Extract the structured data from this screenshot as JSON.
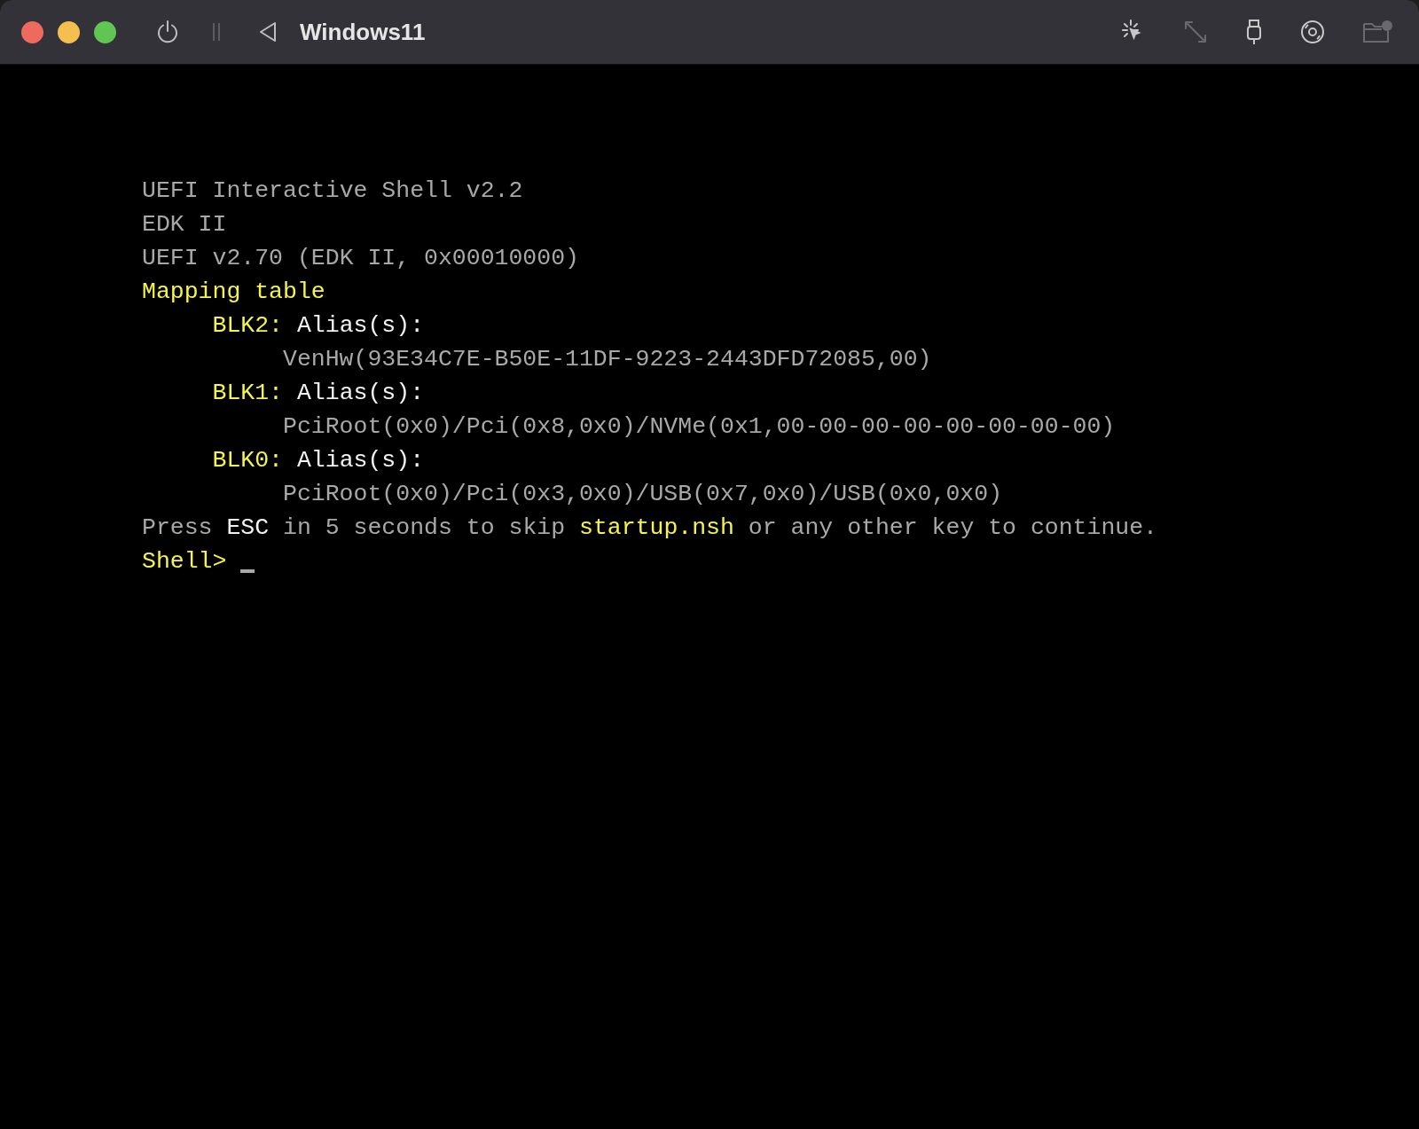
{
  "window": {
    "title": "Windows11"
  },
  "terminal": {
    "cursor": true,
    "lines": [
      {
        "segments": [
          {
            "kind": "plain",
            "text": "UEFI Interactive Shell v2.2"
          }
        ]
      },
      {
        "segments": [
          {
            "kind": "plain",
            "text": "EDK II"
          }
        ]
      },
      {
        "segments": [
          {
            "kind": "plain",
            "text": "UEFI v2.70 (EDK II, 0x00010000)"
          }
        ]
      },
      {
        "segments": [
          {
            "kind": "highlight",
            "text": "Mapping table"
          }
        ],
        "children": [
          {
            "segments": [
              {
                "kind": "highlight",
                "text": "BLK2:"
              },
              {
                "kind": "bright",
                "text": " Alias(s):"
              }
            ],
            "children": [
              {
                "segments": [
                  {
                    "kind": "plain",
                    "text": "VenHw(93E34C7E-B50E-11DF-9223-2443DFD72085,00)"
                  }
                ]
              }
            ]
          },
          {
            "segments": [
              {
                "kind": "highlight",
                "text": "BLK1:"
              },
              {
                "kind": "bright",
                "text": " Alias(s):"
              }
            ],
            "children": [
              {
                "segments": [
                  {
                    "kind": "plain",
                    "text": "PciRoot(0x0)/Pci(0x8,0x0)/NVMe(0x1,00-00-00-00-00-00-00-00)"
                  }
                ]
              }
            ]
          },
          {
            "segments": [
              {
                "kind": "highlight",
                "text": "BLK0:"
              },
              {
                "kind": "bright",
                "text": " Alias(s):"
              }
            ],
            "children": [
              {
                "segments": [
                  {
                    "kind": "plain",
                    "text": "PciRoot(0x0)/Pci(0x3,0x0)/USB(0x7,0x0)/USB(0x0,0x0)"
                  }
                ]
              }
            ]
          }
        ]
      },
      {
        "segments": [
          {
            "kind": "plain",
            "text": "Press "
          },
          {
            "kind": "bright",
            "text": "ESC"
          },
          {
            "kind": "plain",
            "text": " in 5 seconds to skip "
          },
          {
            "kind": "highlight",
            "text": "startup.nsh"
          },
          {
            "kind": "plain",
            "text": " or any other key to continue."
          }
        ]
      },
      {
        "segments": [
          {
            "kind": "highlight",
            "text": "Shell> "
          }
        ]
      }
    ]
  }
}
